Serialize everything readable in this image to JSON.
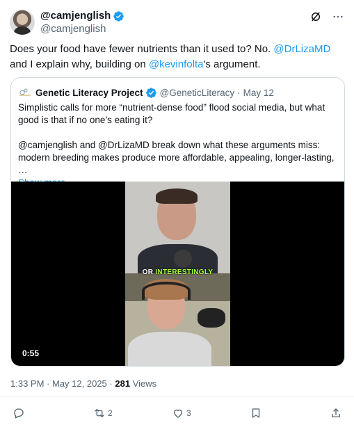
{
  "author": {
    "display_name": "@camjenglish",
    "handle": "@camjenglish"
  },
  "tweet": {
    "text_part1": "Does your food have fewer nutrients than it used to? No. ",
    "mention1": "@DrLizaMD",
    "text_part2": " and I explain why, building on ",
    "mention2": "@kevinfolta",
    "text_part3": "'s argument."
  },
  "quote": {
    "name": "Genetic Literacy Project",
    "handle": "@GeneticLiteracy",
    "separator": "·",
    "date": "May 12",
    "para1": "Simplistic calls for more “nutrient-dense food” flood social media, but what good is that if no one’s eating it?",
    "para2": "@camjenglish and @DrLizaMD break down what these arguments miss: modern breeding makes produce more affordable, appealing, longer-lasting, …",
    "show_more": "Show more",
    "video": {
      "caption_word1": "OR",
      "caption_word2": "INTERESTINGLY",
      "duration": "0:55"
    }
  },
  "meta": {
    "time": "1:33 PM",
    "date": "May 12, 2025",
    "views_count": "281",
    "views_label": "Views"
  },
  "actions": {
    "reply_count": "",
    "retweet_count": "2",
    "like_count": "3"
  },
  "colors": {
    "accent": "#1d9bf0",
    "secondary_text": "#536471",
    "caption_highlight": "#a6ff3a"
  }
}
